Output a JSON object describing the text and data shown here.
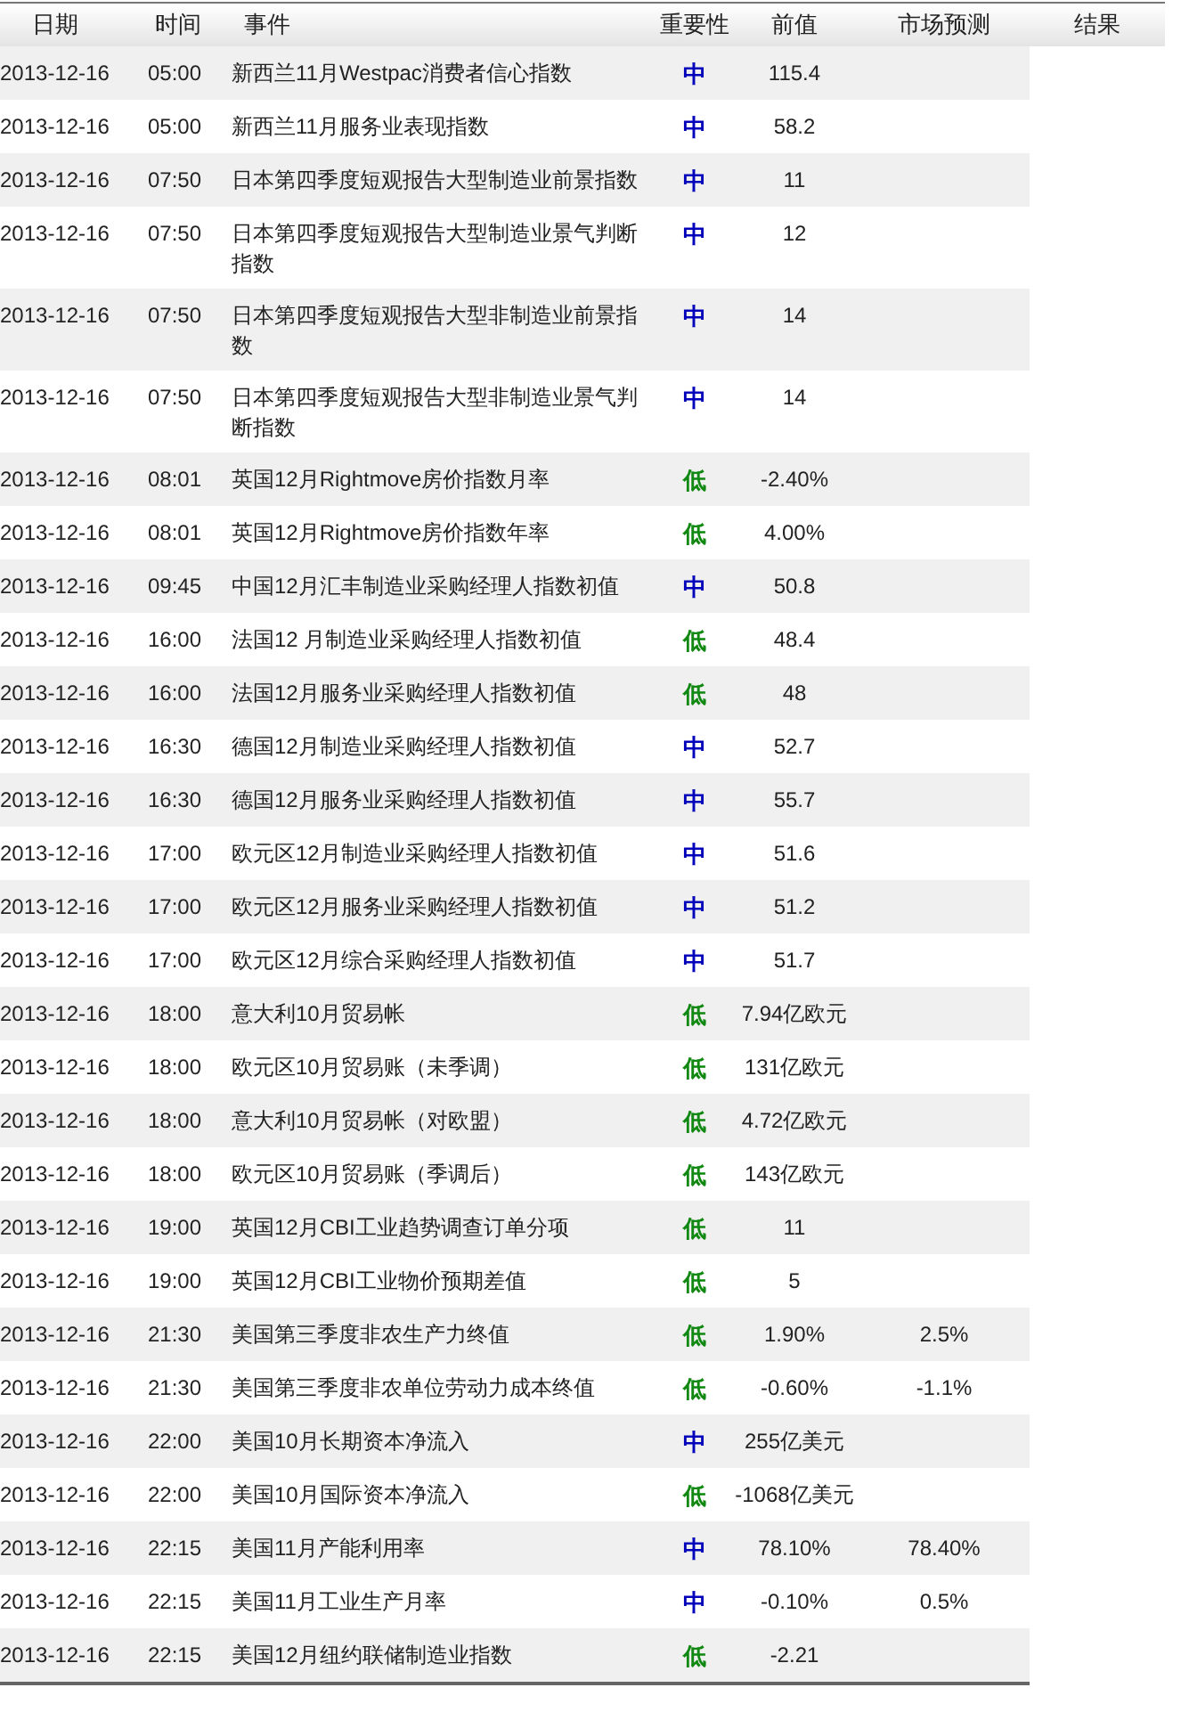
{
  "table": {
    "columns": [
      "日期",
      "时间",
      "事件",
      "重要性",
      "前值",
      "市场预测",
      "结果"
    ],
    "rows": [
      {
        "date": "2013-12-16",
        "time": "05:00",
        "event": "新西兰11月Westpac消费者信心指数",
        "importance": {
          "text": "中",
          "kind": "medium"
        },
        "previous": "115.4"
      },
      {
        "date": "2013-12-16",
        "time": "05:00",
        "event": "新西兰11月服务业表现指数",
        "importance": {
          "text": "中",
          "kind": "medium"
        },
        "previous": "58.2"
      },
      {
        "date": "2013-12-16",
        "time": "07:50",
        "event": "日本第四季度短观报告大型制造业前景指数",
        "importance": {
          "text": "中",
          "kind": "medium"
        },
        "previous": "11"
      },
      {
        "date": "2013-12-16",
        "time": "07:50",
        "event": "日本第四季度短观报告大型制造业景气判断指数",
        "importance": {
          "text": "中",
          "kind": "medium"
        },
        "previous": "12"
      },
      {
        "date": "2013-12-16",
        "time": "07:50",
        "event": "日本第四季度短观报告大型非制造业前景指数",
        "importance": {
          "text": "中",
          "kind": "medium"
        },
        "previous": "14"
      },
      {
        "date": "2013-12-16",
        "time": "07:50",
        "event": "日本第四季度短观报告大型非制造业景气判断指数",
        "importance": {
          "text": "中",
          "kind": "medium"
        },
        "previous": "14"
      },
      {
        "date": "2013-12-16",
        "time": "08:01",
        "event": "英国12月Rightmove房价指数月率",
        "importance": {
          "text": "低",
          "kind": "low"
        },
        "previous": "-2.40%"
      },
      {
        "date": "2013-12-16",
        "time": "08:01",
        "event": "英国12月Rightmove房价指数年率",
        "importance": {
          "text": "低",
          "kind": "low"
        },
        "previous": "4.00%"
      },
      {
        "date": "2013-12-16",
        "time": "09:45",
        "event": "中国12月汇丰制造业采购经理人指数初值",
        "importance": {
          "text": "中",
          "kind": "medium"
        },
        "previous": "50.8"
      },
      {
        "date": "2013-12-16",
        "time": "16:00",
        "event": "法国12 月制造业采购经理人指数初值",
        "importance": {
          "text": "低",
          "kind": "low"
        },
        "previous": "48.4"
      },
      {
        "date": "2013-12-16",
        "time": "16:00",
        "event": "法国12月服务业采购经理人指数初值",
        "importance": {
          "text": "低",
          "kind": "low"
        },
        "previous": "48"
      },
      {
        "date": "2013-12-16",
        "time": "16:30",
        "event": "德国12月制造业采购经理人指数初值",
        "importance": {
          "text": "中",
          "kind": "medium"
        },
        "previous": "52.7"
      },
      {
        "date": "2013-12-16",
        "time": "16:30",
        "event": "德国12月服务业采购经理人指数初值",
        "importance": {
          "text": "中",
          "kind": "medium"
        },
        "previous": "55.7"
      },
      {
        "date": "2013-12-16",
        "time": "17:00",
        "event": "欧元区12月制造业采购经理人指数初值",
        "importance": {
          "text": "中",
          "kind": "medium"
        },
        "previous": "51.6"
      },
      {
        "date": "2013-12-16",
        "time": "17:00",
        "event": "欧元区12月服务业采购经理人指数初值",
        "importance": {
          "text": "中",
          "kind": "medium"
        },
        "previous": "51.2"
      },
      {
        "date": "2013-12-16",
        "time": "17:00",
        "event": "欧元区12月综合采购经理人指数初值",
        "importance": {
          "text": "中",
          "kind": "medium"
        },
        "previous": "51.7"
      },
      {
        "date": "2013-12-16",
        "time": "18:00",
        "event": "意大利10月贸易帐",
        "importance": {
          "text": "低",
          "kind": "low"
        },
        "previous": "7.94亿欧元"
      },
      {
        "date": "2013-12-16",
        "time": "18:00",
        "event": "欧元区10月贸易账（未季调）",
        "importance": {
          "text": "低",
          "kind": "low"
        },
        "previous": "131亿欧元"
      },
      {
        "date": "2013-12-16",
        "time": "18:00",
        "event": "意大利10月贸易帐（对欧盟）",
        "importance": {
          "text": "低",
          "kind": "low"
        },
        "previous": "4.72亿欧元"
      },
      {
        "date": "2013-12-16",
        "time": "18:00",
        "event": "欧元区10月贸易账（季调后）",
        "importance": {
          "text": "低",
          "kind": "low"
        },
        "previous": "143亿欧元"
      },
      {
        "date": "2013-12-16",
        "time": "19:00",
        "event": "英国12月CBI工业趋势调查订单分项",
        "importance": {
          "text": "低",
          "kind": "low"
        },
        "previous": "11"
      },
      {
        "date": "2013-12-16",
        "time": "19:00",
        "event": "英国12月CBI工业物价预期差值",
        "importance": {
          "text": "低",
          "kind": "low"
        },
        "previous": "5"
      },
      {
        "date": "2013-12-16",
        "time": "21:30",
        "event": "美国第三季度非农生产力终值",
        "importance": {
          "text": "低",
          "kind": "low"
        },
        "previous": "1.90%",
        "forecast": "2.5%"
      },
      {
        "date": "2013-12-16",
        "time": "21:30",
        "event": "美国第三季度非农单位劳动力成本终值",
        "importance": {
          "text": "低",
          "kind": "low"
        },
        "previous": "-0.60%",
        "forecast": "-1.1%"
      },
      {
        "date": "2013-12-16",
        "time": "22:00",
        "event": "美国10月长期资本净流入",
        "importance": {
          "text": "中",
          "kind": "medium"
        },
        "previous": "255亿美元"
      },
      {
        "date": "2013-12-16",
        "time": "22:00",
        "event": "美国10月国际资本净流入",
        "importance": {
          "text": "低",
          "kind": "low"
        },
        "previous": "-1068亿美元"
      },
      {
        "date": "2013-12-16",
        "time": "22:15",
        "event": "美国11月产能利用率",
        "importance": {
          "text": "中",
          "kind": "medium"
        },
        "previous": "78.10%",
        "forecast": "78.40%"
      },
      {
        "date": "2013-12-16",
        "time": "22:15",
        "event": "美国11月工业生产月率",
        "importance": {
          "text": "中",
          "kind": "medium"
        },
        "previous": "-0.10%",
        "forecast": "0.5%"
      },
      {
        "date": "2013-12-16",
        "time": "22:15",
        "event": "美国12月纽约联储制造业指数",
        "importance": {
          "text": "低",
          "kind": "low"
        },
        "previous": "-2.21"
      }
    ]
  }
}
